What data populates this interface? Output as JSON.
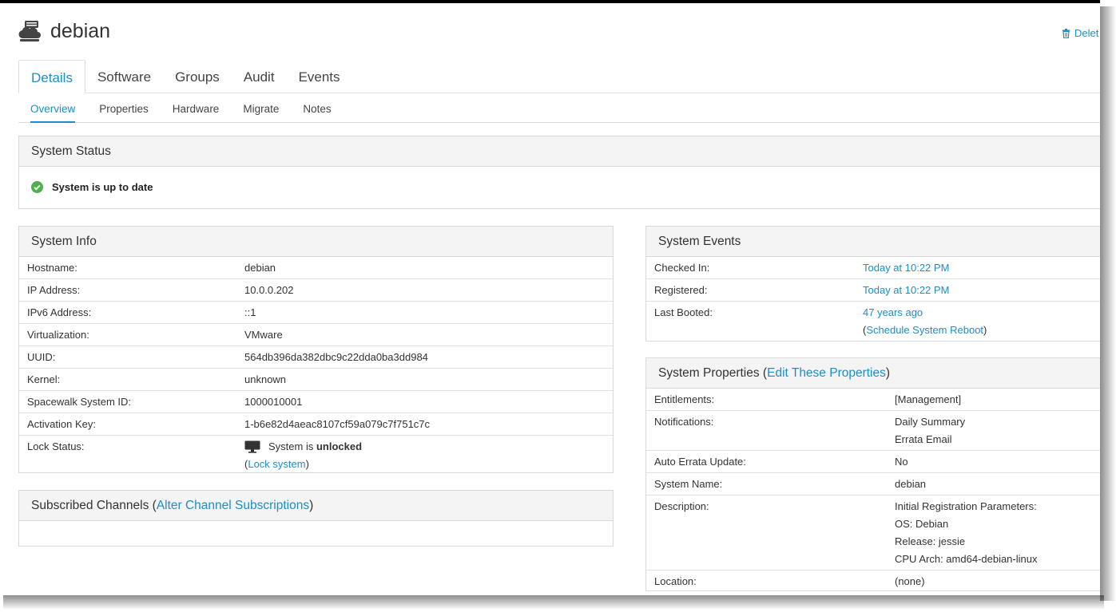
{
  "header": {
    "title": "debian",
    "delete_label": "Delet"
  },
  "tabs": [
    {
      "label": "Details"
    },
    {
      "label": "Software"
    },
    {
      "label": "Groups"
    },
    {
      "label": "Audit"
    },
    {
      "label": "Events"
    }
  ],
  "subtabs": [
    {
      "label": "Overview"
    },
    {
      "label": "Properties"
    },
    {
      "label": "Hardware"
    },
    {
      "label": "Migrate"
    },
    {
      "label": "Notes"
    }
  ],
  "system_status": {
    "title": "System Status",
    "message": "System is up to date"
  },
  "system_info": {
    "title": "System Info",
    "rows": [
      {
        "key": "Hostname:",
        "value": "debian"
      },
      {
        "key": "IP Address:",
        "value": "10.0.0.202"
      },
      {
        "key": "IPv6 Address:",
        "value": "::1"
      },
      {
        "key": "Virtualization:",
        "value": "VMware"
      },
      {
        "key": "UUID:",
        "value": "564db396da382dbc9c22dda0ba3dd984"
      },
      {
        "key": "Kernel:",
        "value": "unknown"
      },
      {
        "key": "Spacewalk System ID:",
        "value": "1000010001"
      },
      {
        "key": "Activation Key:",
        "value": "1-b6e82d4aeac8107cf59a079c7f751c7c"
      }
    ],
    "lock": {
      "key": "Lock Status:",
      "prefix": "System is ",
      "state": "unlocked",
      "link_open": "(",
      "link": "Lock system",
      "link_close": ")"
    }
  },
  "subscribed_channels": {
    "title": "Subscribed Channels (",
    "link": "Alter Channel Subscriptions",
    "close": ")"
  },
  "system_events": {
    "title": "System Events",
    "rows": [
      {
        "key": "Checked In:",
        "value": "Today at 10:22 PM"
      },
      {
        "key": "Registered:",
        "value": "Today at 10:22 PM"
      },
      {
        "key": "Last Booted:",
        "value": "47 years ago"
      }
    ],
    "reboot_open": "(",
    "reboot_link": "Schedule System Reboot",
    "reboot_close": ")"
  },
  "system_properties": {
    "title": "System Properties (",
    "link": "Edit These Properties",
    "close": ")",
    "entitlements": {
      "key": "Entitlements:",
      "value": "[Management]"
    },
    "notifications": {
      "key": "Notifications:",
      "values": [
        "Daily Summary",
        "Errata Email"
      ]
    },
    "auto_errata": {
      "key": "Auto Errata Update:",
      "value": "No"
    },
    "system_name": {
      "key": "System Name:",
      "value": "debian"
    },
    "description": {
      "key": "Description:",
      "values": [
        "Initial Registration Parameters:",
        "OS: Debian",
        "Release: jessie",
        "CPU Arch: amd64-debian-linux"
      ]
    },
    "location": {
      "key": "Location:",
      "value": "(none)"
    }
  },
  "colors": {
    "link": "#1b8fc7",
    "success": "#4cb04c",
    "panel_header": "#f4f4f4"
  },
  "icons": [
    "server-icon",
    "trash-icon",
    "check-circle-icon",
    "desktop-icon"
  ]
}
